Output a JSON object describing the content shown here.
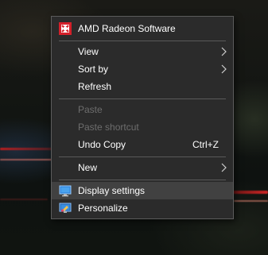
{
  "menu": {
    "items": [
      {
        "label": "AMD Radeon Software",
        "icon": "amd-radeon-icon"
      },
      {
        "label": "View",
        "submenu": true
      },
      {
        "label": "Sort by",
        "submenu": true
      },
      {
        "label": "Refresh"
      },
      {
        "label": "Paste",
        "disabled": true
      },
      {
        "label": "Paste shortcut",
        "disabled": true
      },
      {
        "label": "Undo Copy",
        "shortcut": "Ctrl+Z"
      },
      {
        "label": "New",
        "submenu": true
      },
      {
        "label": "Display settings",
        "icon": "display-settings-icon",
        "highlighted": true
      },
      {
        "label": "Personalize",
        "icon": "personalize-icon"
      }
    ]
  },
  "colors": {
    "menu_background": "#2b2b2b",
    "menu_border": "#5c5c5c",
    "highlight": "#414141",
    "disabled_text": "#6d6d6d",
    "amd_red": "#d4202a"
  }
}
